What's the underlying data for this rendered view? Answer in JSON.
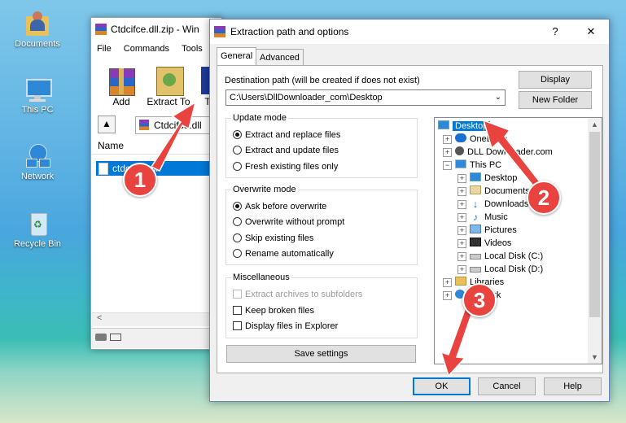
{
  "desktop": {
    "icons": [
      {
        "label": "Documents",
        "icon": "folder-user-icon"
      },
      {
        "label": "This PC",
        "icon": "computer-icon"
      },
      {
        "label": "Network",
        "icon": "network-icon"
      },
      {
        "label": "Recycle Bin",
        "icon": "recycle-bin-icon"
      }
    ]
  },
  "winrar": {
    "title": "Ctdcifce.dll.zip - Win",
    "menu": [
      "File",
      "Commands",
      "Tools"
    ],
    "toolbar": {
      "add": "Add",
      "extract_to": "Extract To",
      "third": "T"
    },
    "path": "Ctdcifce.dll",
    "column_name": "Name",
    "file": "ctdcifce.dll",
    "scroll_left": "<"
  },
  "dialog": {
    "title": "Extraction path and options",
    "help": "?",
    "close": "✕",
    "tabs": [
      "General",
      "Advanced"
    ],
    "dest_label": "Destination path (will be created if does not exist)",
    "dest_value": "C:\\Users\\DllDownloader_com\\Desktop",
    "display_btn": "Display",
    "new_folder_btn": "New Folder",
    "update_mode": {
      "label": "Update mode",
      "options": [
        "Extract and replace files",
        "Extract and update files",
        "Fresh existing files only"
      ],
      "selected": 0
    },
    "overwrite_mode": {
      "label": "Overwrite mode",
      "options": [
        "Ask before overwrite",
        "Overwrite without prompt",
        "Skip existing files",
        "Rename automatically"
      ],
      "selected": 0
    },
    "misc": {
      "label": "Miscellaneous",
      "options": [
        "Extract archives to subfolders",
        "Keep broken files",
        "Display files in Explorer"
      ]
    },
    "save_settings": "Save settings",
    "tree": [
      "Desktop",
      "OneDrive",
      "DLL Downloader.com",
      "This PC",
      "Desktop",
      "Documents",
      "Downloads",
      "Music",
      "Pictures",
      "Videos",
      "Local Disk (C:)",
      "Local Disk (D:)",
      "Libraries",
      "Network"
    ],
    "ok": "OK",
    "cancel": "Cancel",
    "help_btn": "Help"
  },
  "steps": [
    "1",
    "2",
    "3"
  ],
  "colors": {
    "accent": "#0078d7",
    "step": "#e8433f",
    "selection": "#0078d7"
  }
}
